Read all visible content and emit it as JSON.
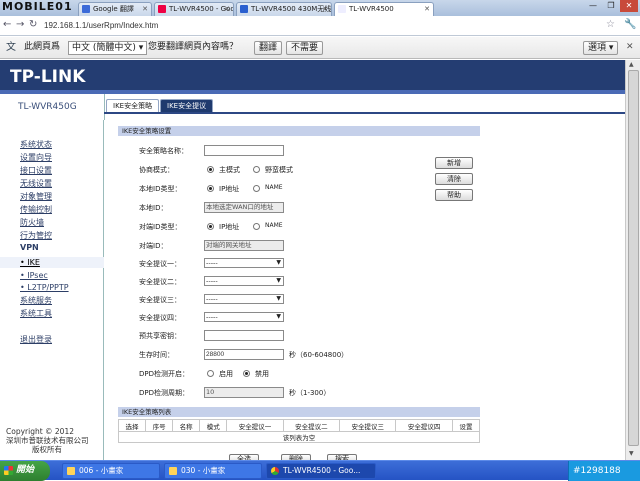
{
  "watermark": "MOBILE01",
  "browser": {
    "tabs": [
      {
        "label": "Google 翻譯",
        "active": false
      },
      {
        "label": "TL-WVR4500 - Google",
        "active": false
      },
      {
        "label": "TL-WVR4500 430M无线...",
        "active": false
      },
      {
        "label": "TL-WVR4500",
        "active": true
      }
    ],
    "url": "192.168.1.1/userRpm/Index.htm"
  },
  "translate_bar": {
    "prefix": "此網頁爲",
    "language": "中文 (簡體中文)",
    "question": "您要翻譯網頁內容嗎？",
    "translate_button": "翻譯",
    "no_button": "不需要",
    "options_button": "選項"
  },
  "header": {
    "logo": "TP-LINK",
    "model": "TL-WVR450G"
  },
  "page_tabs": [
    {
      "label": "IKE安全策略",
      "active": true
    },
    {
      "label": "IKE安全提议",
      "active": false
    }
  ],
  "sidebar": {
    "items": [
      {
        "label": "系统状态",
        "style": "link"
      },
      {
        "label": "设置向导",
        "style": "link"
      },
      {
        "label": "接口设置",
        "style": "link"
      },
      {
        "label": "无线设置",
        "style": "link"
      },
      {
        "label": "对象管理",
        "style": "link"
      },
      {
        "label": "传输控制",
        "style": "link"
      },
      {
        "label": "防火墙",
        "style": "link"
      },
      {
        "label": "行为管控",
        "style": "link"
      },
      {
        "label": "VPN",
        "style": "bold"
      },
      {
        "label": "• IKE",
        "style": "current"
      },
      {
        "label": "• IPsec",
        "style": "sub"
      },
      {
        "label": "• L2TP/PPTP",
        "style": "sub"
      },
      {
        "label": "系统服务",
        "style": "link"
      },
      {
        "label": "系统工具",
        "style": "link"
      },
      {
        "label": "退出登录",
        "style": "link"
      }
    ],
    "copyright": [
      "Copyright © 2012",
      "深圳市普联技术有限公司",
      "版权所有"
    ]
  },
  "form": {
    "section_title": "IKE安全策略设置",
    "policy_name_label": "安全策略名称：",
    "policy_name_value": "",
    "mode_label": "协商模式：",
    "mode_options": [
      "主模式",
      "野蛮模式"
    ],
    "mode_selected": 0,
    "local_id_type_label": "本地ID类型：",
    "local_id_type_options": [
      "IP地址",
      "NAME"
    ],
    "local_id_type_selected": 0,
    "local_id_label": "本地ID：",
    "local_id_value": "本地选定WAN口的地址",
    "peer_id_type_label": "对端ID类型：",
    "peer_id_type_options": [
      "IP地址",
      "NAME"
    ],
    "peer_id_type_selected": 0,
    "peer_id_label": "对端ID：",
    "peer_id_value": "对端的网关地址",
    "proposals": [
      {
        "label": "安全提议一：",
        "value": "-----"
      },
      {
        "label": "安全提议二：",
        "value": "-----"
      },
      {
        "label": "安全提议三：",
        "value": "-----"
      },
      {
        "label": "安全提议四：",
        "value": "-----"
      }
    ],
    "psk_label": "预共享密钥：",
    "psk_value": "",
    "lifetime_label": "生存时间：",
    "lifetime_value": "28800",
    "lifetime_unit": "秒（60-604800）",
    "dpd_label": "DPD检测开启：",
    "dpd_options": [
      "启用",
      "禁用"
    ],
    "dpd_selected": 1,
    "dpd_period_label": "DPD检测周期：",
    "dpd_period_value": "10",
    "dpd_period_unit": "秒（1-300）",
    "buttons": {
      "add": "新增",
      "clear": "清除",
      "help": "帮助"
    }
  },
  "list": {
    "title": "IKE安全策略列表",
    "columns": [
      "选择",
      "序号",
      "名称",
      "模式",
      "安全提议一",
      "安全提议二",
      "安全提议三",
      "安全提议四",
      "设置"
    ],
    "empty_text": "该列表为空",
    "buttons": {
      "select_all": "全选",
      "delete": "删除",
      "search": "搜索"
    }
  },
  "taskbar": {
    "start": "開始",
    "tasks": [
      {
        "label": "006 - 小畫家",
        "active": false
      },
      {
        "label": "030 - 小畫家",
        "active": false
      },
      {
        "label": "TL-WVR4500 - Goo...",
        "active": true
      }
    ],
    "tray_text": "#1298188"
  }
}
